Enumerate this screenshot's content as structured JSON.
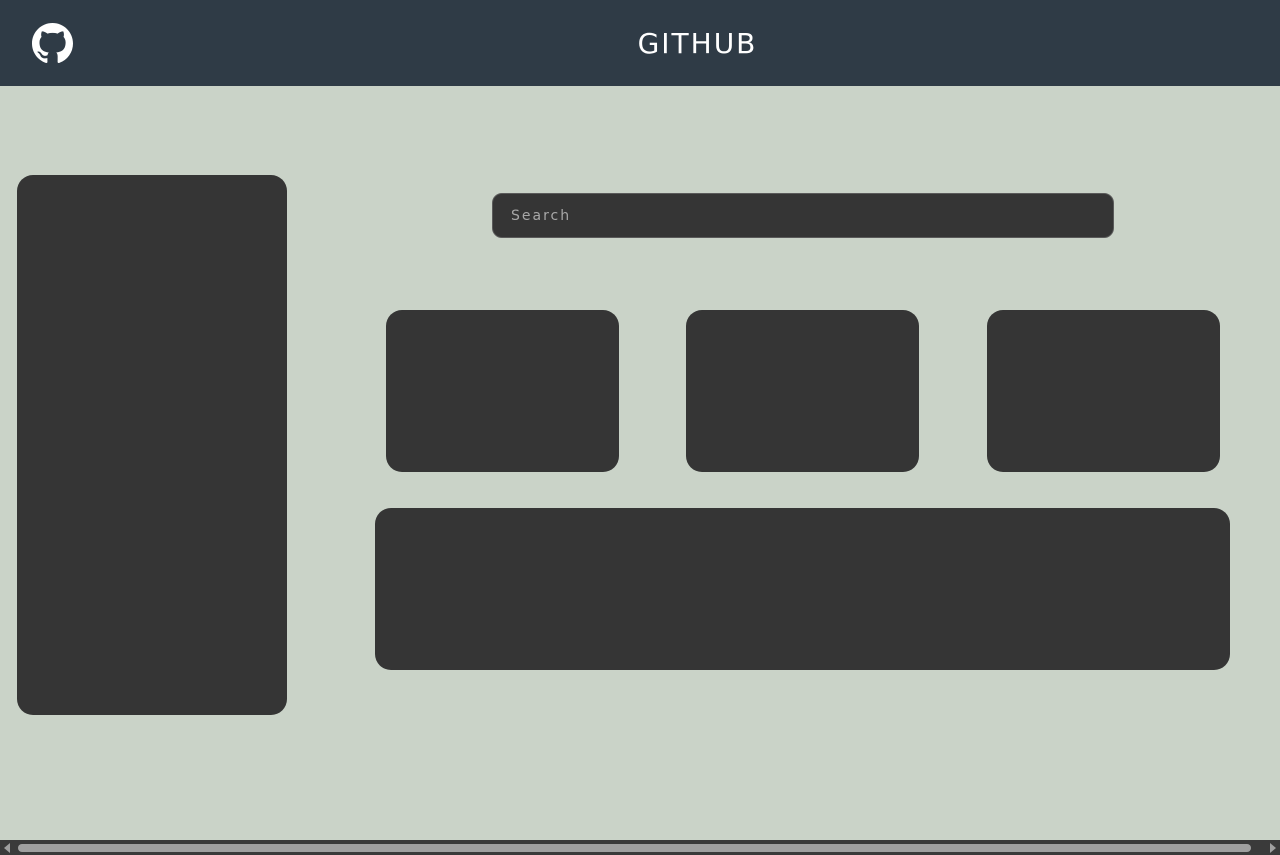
{
  "header": {
    "title": "GITHUB",
    "logo_icon": "github-icon"
  },
  "search": {
    "placeholder": "Search",
    "value": ""
  },
  "colors": {
    "header_bg": "#2f3b46",
    "page_bg": "#cad3c8",
    "panel_bg": "#353535",
    "header_text": "#ffffff"
  }
}
